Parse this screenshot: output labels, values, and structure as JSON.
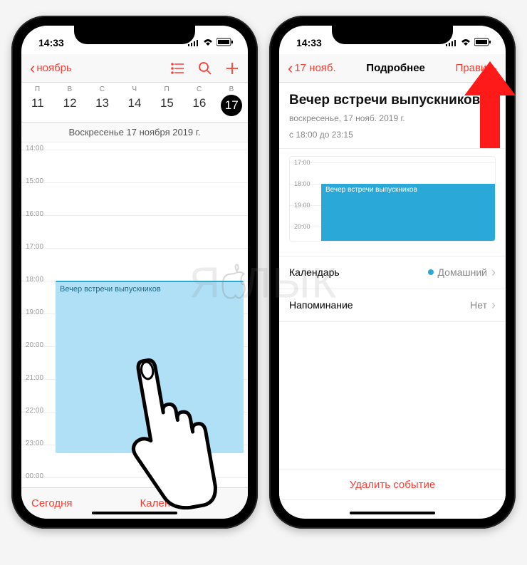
{
  "status": {
    "time": "14:33"
  },
  "left": {
    "back_label": "ноябрь",
    "days": [
      {
        "dow": "П",
        "num": "11"
      },
      {
        "dow": "В",
        "num": "12"
      },
      {
        "dow": "С",
        "num": "13"
      },
      {
        "dow": "Ч",
        "num": "14"
      },
      {
        "dow": "П",
        "num": "15"
      },
      {
        "dow": "С",
        "num": "16"
      },
      {
        "dow": "В",
        "num": "17",
        "selected": true
      }
    ],
    "full_date": "Воскресенье  17 ноября 2019 г.",
    "hours": [
      "14:00",
      "15:00",
      "16:00",
      "17:00",
      "18:00",
      "19:00",
      "20:00",
      "21:00",
      "22:00",
      "23:00",
      "00:00"
    ],
    "event_title": "Вечер встречи выпускников",
    "today_label": "Сегодня",
    "calendars_label": "Кален"
  },
  "right": {
    "back_label": "17 нояб.",
    "title": "Подробнее",
    "edit_label": "Править",
    "event_title": "Вечер встречи выпускников",
    "event_sub_line1": "воскресенье, 17 нояб. 2019 г.",
    "event_sub_line2": "с 18:00 до 23:15",
    "mini_hours": [
      "17:00",
      "18:00",
      "19:00",
      "20:00"
    ],
    "mini_event_label": "Вечер встречи выпускников",
    "calendar_label": "Календарь",
    "calendar_value": "Домашний",
    "reminder_label": "Напоминание",
    "reminder_value": "Нет",
    "delete_label": "Удалить событие"
  },
  "watermark": "ЯБЛЫК"
}
